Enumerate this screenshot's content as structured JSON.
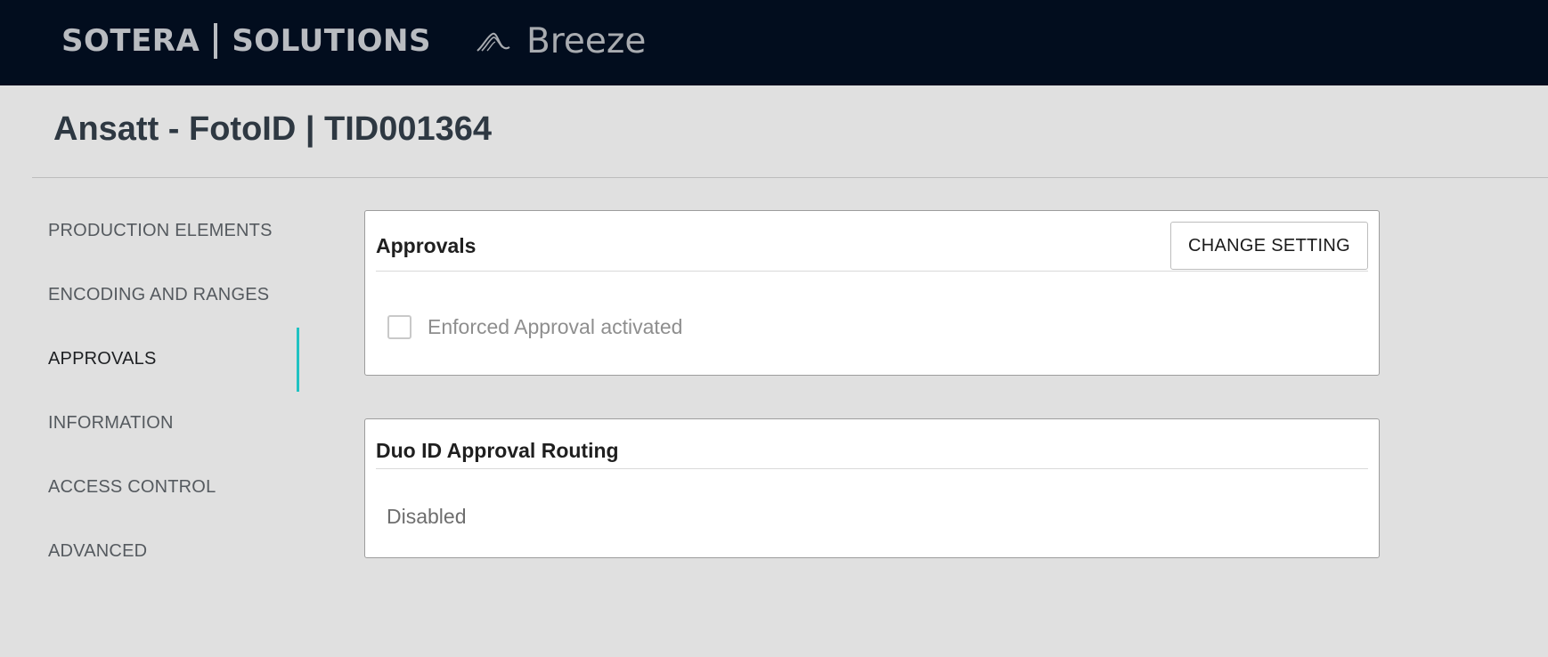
{
  "header": {
    "brand_left": "SOTERA",
    "brand_right": "SOLUTIONS",
    "product_name": "Breeze",
    "logo_icon": "breeze-wave-icon"
  },
  "page": {
    "title": "Ansatt - FotoID | TID001364"
  },
  "sidebar": {
    "items": [
      {
        "label": "PRODUCTION ELEMENTS"
      },
      {
        "label": "ENCODING AND RANGES"
      },
      {
        "label": "APPROVALS"
      },
      {
        "label": "INFORMATION"
      },
      {
        "label": "ACCESS CONTROL"
      },
      {
        "label": "ADVANCED"
      }
    ],
    "active_index": 2,
    "accent_color": "#20c2c2"
  },
  "approvals": {
    "title": "Approvals",
    "change_button": "CHANGE SETTING",
    "checkbox_label": "Enforced Approval activated",
    "checkbox_checked": false
  },
  "routing": {
    "title": "Duo ID Approval Routing",
    "status": "Disabled"
  },
  "colors": {
    "topbar": "#020d1e",
    "background": "#e0e0e0"
  }
}
